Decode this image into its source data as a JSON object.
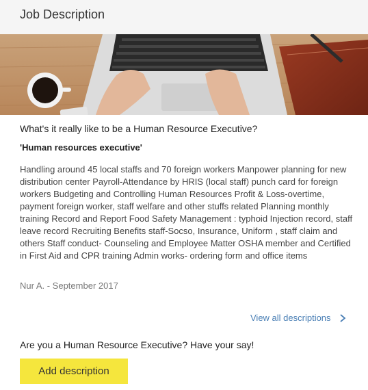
{
  "header": {
    "title": "Job Description"
  },
  "content": {
    "question": "What's it really like to be a Human Resource Executive?",
    "job_title": "'Human resources executive'",
    "description": "Handling around 45 local staffs and 70 foreign workers Manpower planning for new distribution center Payroll-Attendance by HRIS (local staff) punch card for foreign workers Budgeting and Controlling Human Resources Profit & Loss-overtime, payment foreign worker, staff welfare and other stuffs related Planning monthly training Record and Report Food Safety Management : typhoid Injection record, staff leave record Recruiting Benefits staff-Socso, Insurance, Uniform , staff claim and others Staff conduct- Counseling and Employee Matter OSHA member and Certified in First Aid and CPR training Admin works- ordering form and office items",
    "author_line": "Nur A. - September 2017",
    "view_all_label": "View all descriptions"
  },
  "cta": {
    "prompt": "Are you a Human Resource Executive? Have your say!",
    "button_label": "Add description"
  },
  "colors": {
    "link": "#4a7fb5",
    "button_bg": "#f5e63d",
    "header_bg": "#f5f5f5"
  }
}
